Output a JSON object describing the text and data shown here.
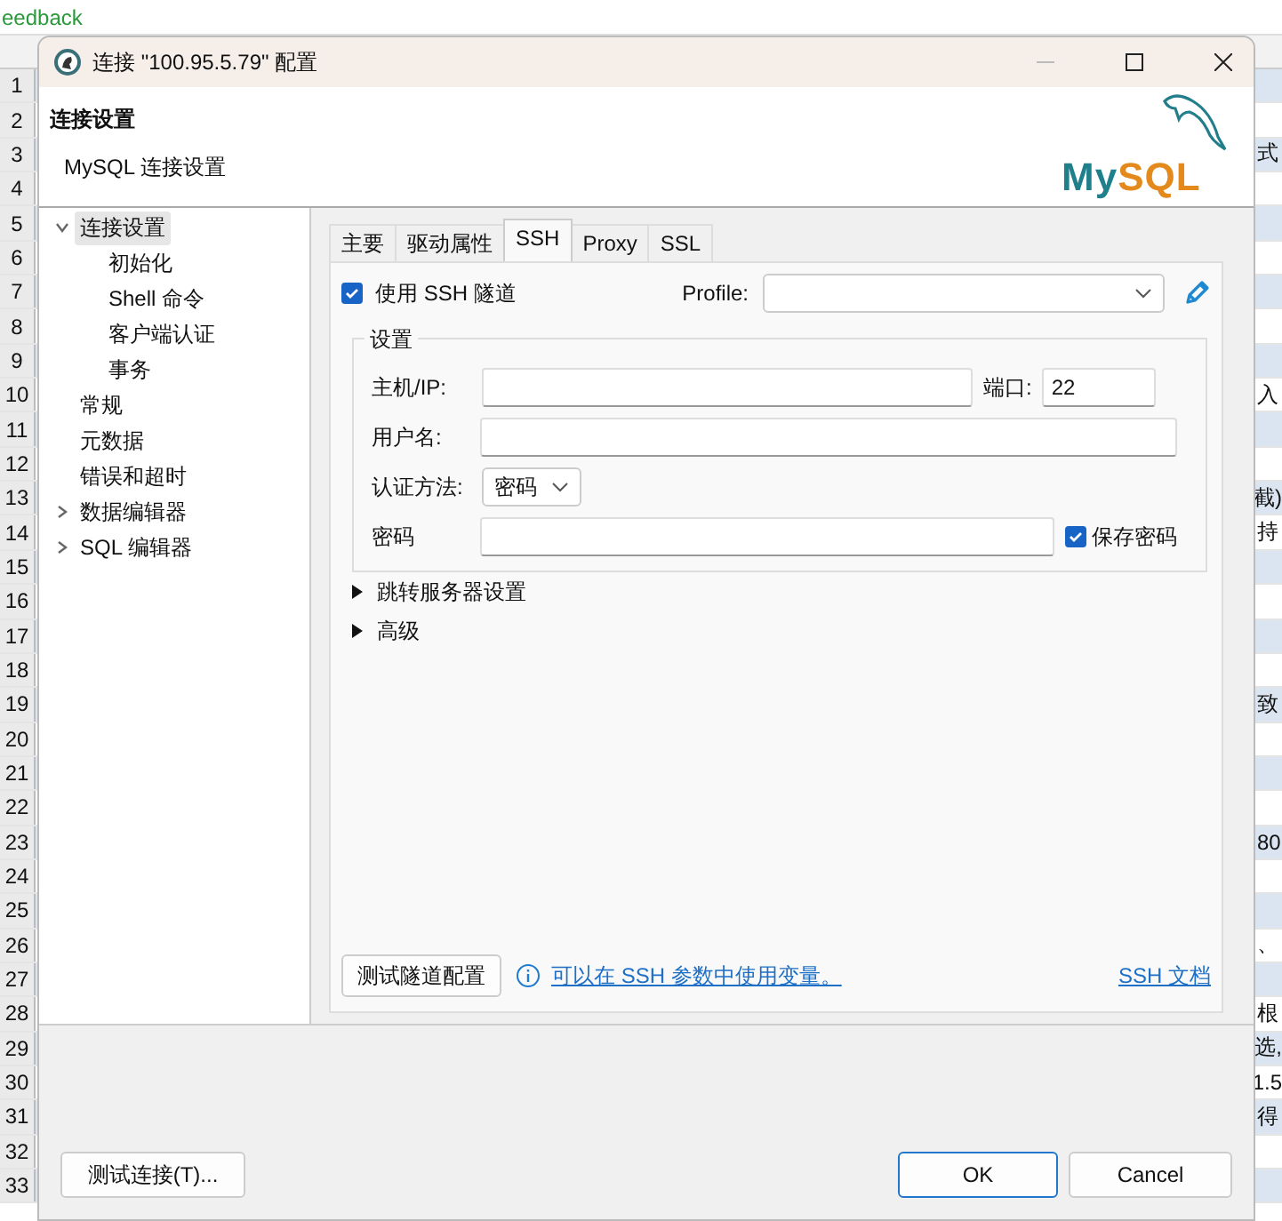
{
  "background": {
    "toolbar_text": "eedback",
    "rows": [
      {
        "number": "1",
        "text": ""
      },
      {
        "number": "2",
        "text": ""
      },
      {
        "number": "3",
        "text": "式"
      },
      {
        "number": "4",
        "text": ""
      },
      {
        "number": "5",
        "text": ""
      },
      {
        "number": "6",
        "text": ""
      },
      {
        "number": "7",
        "text": ""
      },
      {
        "number": "8",
        "text": ""
      },
      {
        "number": "9",
        "text": ""
      },
      {
        "number": "10",
        "text": "入"
      },
      {
        "number": "11",
        "text": ""
      },
      {
        "number": "12",
        "text": ""
      },
      {
        "number": "13",
        "text": "截)"
      },
      {
        "number": "14",
        "text": "持"
      },
      {
        "number": "15",
        "text": ""
      },
      {
        "number": "16",
        "text": ""
      },
      {
        "number": "17",
        "text": ""
      },
      {
        "number": "18",
        "text": ""
      },
      {
        "number": "19",
        "text": "致"
      },
      {
        "number": "20",
        "text": ""
      },
      {
        "number": "21",
        "text": ""
      },
      {
        "number": "22",
        "text": ""
      },
      {
        "number": "23",
        "text": "80"
      },
      {
        "number": "24",
        "text": ""
      },
      {
        "number": "25",
        "text": ""
      },
      {
        "number": "26",
        "text": "、"
      },
      {
        "number": "27",
        "text": ""
      },
      {
        "number": "28",
        "text": "根"
      },
      {
        "number": "29",
        "text": "选,"
      },
      {
        "number": "30",
        "text": "1.5"
      },
      {
        "number": "31",
        "text": "得"
      },
      {
        "number": "32",
        "text": ""
      },
      {
        "number": "33",
        "text": ""
      }
    ]
  },
  "dialog": {
    "title": "连接 \"100.95.5.79\" 配置",
    "header": {
      "title": "连接设置",
      "subtitle": "MySQL 连接设置",
      "logo_text": [
        "My",
        "SQL"
      ]
    },
    "tree": [
      {
        "label": "连接设置",
        "kind": "folder",
        "expanded": true,
        "selected": true,
        "children": [
          {
            "label": "初始化",
            "selected": false
          },
          {
            "label": "Shell 命令",
            "selected": false
          },
          {
            "label": "客户端认证",
            "selected": false
          },
          {
            "label": "事务",
            "selected": false
          }
        ]
      },
      {
        "label": "常规",
        "kind": "leaf",
        "selected": false
      },
      {
        "label": "元数据",
        "kind": "leaf",
        "selected": false
      },
      {
        "label": "错误和超时",
        "kind": "leaf",
        "selected": false
      },
      {
        "label": "数据编辑器",
        "kind": "folder",
        "expanded": false,
        "selected": false
      },
      {
        "label": "SQL 编辑器",
        "kind": "folder",
        "expanded": false,
        "selected": false
      }
    ],
    "tabs": [
      {
        "label": "主要",
        "selected": false
      },
      {
        "label": "驱动属性",
        "selected": false
      },
      {
        "label": "SSH",
        "selected": true
      },
      {
        "label": "Proxy",
        "selected": false
      },
      {
        "label": "SSL",
        "selected": false
      }
    ],
    "ssh": {
      "use_tunnel": {
        "label": "使用 SSH 隧道",
        "checked": true
      },
      "profile_label": "Profile:",
      "settings": {
        "legend": "设置",
        "host_label": "主机/IP:",
        "port_label": "端口:",
        "port_value": "22",
        "user_label": "用户名:",
        "auth_label": "认证方法:",
        "auth_value": "密码",
        "password_label": "密码",
        "save_password": {
          "label": "保存密码",
          "checked": true
        }
      },
      "sections": [
        {
          "label": "跳转服务器设置",
          "expanded": false
        },
        {
          "label": "高级",
          "expanded": false
        }
      ],
      "test_button": "测试隧道配置",
      "info_link": "可以在 SSH 参数中使用变量。",
      "docs_link": "SSH 文档"
    },
    "buttons": {
      "test": "测试连接(T)...",
      "ok": "OK",
      "cancel": "Cancel"
    }
  }
}
